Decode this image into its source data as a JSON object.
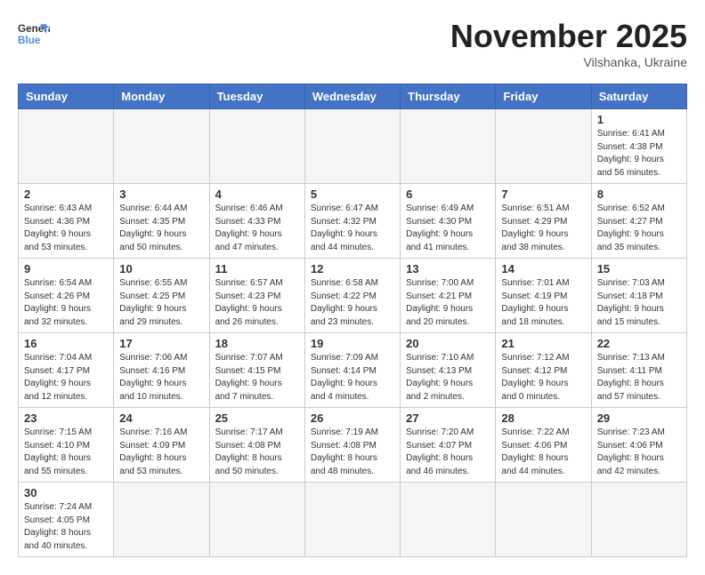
{
  "logo": {
    "line1": "General",
    "line2": "Blue"
  },
  "title": "November 2025",
  "subtitle": "Vilshanka, Ukraine",
  "days_of_week": [
    "Sunday",
    "Monday",
    "Tuesday",
    "Wednesday",
    "Thursday",
    "Friday",
    "Saturday"
  ],
  "weeks": [
    [
      {
        "day": "",
        "info": ""
      },
      {
        "day": "",
        "info": ""
      },
      {
        "day": "",
        "info": ""
      },
      {
        "day": "",
        "info": ""
      },
      {
        "day": "",
        "info": ""
      },
      {
        "day": "",
        "info": ""
      },
      {
        "day": "1",
        "info": "Sunrise: 6:41 AM\nSunset: 4:38 PM\nDaylight: 9 hours\nand 56 minutes."
      }
    ],
    [
      {
        "day": "2",
        "info": "Sunrise: 6:43 AM\nSunset: 4:36 PM\nDaylight: 9 hours\nand 53 minutes."
      },
      {
        "day": "3",
        "info": "Sunrise: 6:44 AM\nSunset: 4:35 PM\nDaylight: 9 hours\nand 50 minutes."
      },
      {
        "day": "4",
        "info": "Sunrise: 6:46 AM\nSunset: 4:33 PM\nDaylight: 9 hours\nand 47 minutes."
      },
      {
        "day": "5",
        "info": "Sunrise: 6:47 AM\nSunset: 4:32 PM\nDaylight: 9 hours\nand 44 minutes."
      },
      {
        "day": "6",
        "info": "Sunrise: 6:49 AM\nSunset: 4:30 PM\nDaylight: 9 hours\nand 41 minutes."
      },
      {
        "day": "7",
        "info": "Sunrise: 6:51 AM\nSunset: 4:29 PM\nDaylight: 9 hours\nand 38 minutes."
      },
      {
        "day": "8",
        "info": "Sunrise: 6:52 AM\nSunset: 4:27 PM\nDaylight: 9 hours\nand 35 minutes."
      }
    ],
    [
      {
        "day": "9",
        "info": "Sunrise: 6:54 AM\nSunset: 4:26 PM\nDaylight: 9 hours\nand 32 minutes."
      },
      {
        "day": "10",
        "info": "Sunrise: 6:55 AM\nSunset: 4:25 PM\nDaylight: 9 hours\nand 29 minutes."
      },
      {
        "day": "11",
        "info": "Sunrise: 6:57 AM\nSunset: 4:23 PM\nDaylight: 9 hours\nand 26 minutes."
      },
      {
        "day": "12",
        "info": "Sunrise: 6:58 AM\nSunset: 4:22 PM\nDaylight: 9 hours\nand 23 minutes."
      },
      {
        "day": "13",
        "info": "Sunrise: 7:00 AM\nSunset: 4:21 PM\nDaylight: 9 hours\nand 20 minutes."
      },
      {
        "day": "14",
        "info": "Sunrise: 7:01 AM\nSunset: 4:19 PM\nDaylight: 9 hours\nand 18 minutes."
      },
      {
        "day": "15",
        "info": "Sunrise: 7:03 AM\nSunset: 4:18 PM\nDaylight: 9 hours\nand 15 minutes."
      }
    ],
    [
      {
        "day": "16",
        "info": "Sunrise: 7:04 AM\nSunset: 4:17 PM\nDaylight: 9 hours\nand 12 minutes."
      },
      {
        "day": "17",
        "info": "Sunrise: 7:06 AM\nSunset: 4:16 PM\nDaylight: 9 hours\nand 10 minutes."
      },
      {
        "day": "18",
        "info": "Sunrise: 7:07 AM\nSunset: 4:15 PM\nDaylight: 9 hours\nand 7 minutes."
      },
      {
        "day": "19",
        "info": "Sunrise: 7:09 AM\nSunset: 4:14 PM\nDaylight: 9 hours\nand 4 minutes."
      },
      {
        "day": "20",
        "info": "Sunrise: 7:10 AM\nSunset: 4:13 PM\nDaylight: 9 hours\nand 2 minutes."
      },
      {
        "day": "21",
        "info": "Sunrise: 7:12 AM\nSunset: 4:12 PM\nDaylight: 9 hours\nand 0 minutes."
      },
      {
        "day": "22",
        "info": "Sunrise: 7:13 AM\nSunset: 4:11 PM\nDaylight: 8 hours\nand 57 minutes."
      }
    ],
    [
      {
        "day": "23",
        "info": "Sunrise: 7:15 AM\nSunset: 4:10 PM\nDaylight: 8 hours\nand 55 minutes."
      },
      {
        "day": "24",
        "info": "Sunrise: 7:16 AM\nSunset: 4:09 PM\nDaylight: 8 hours\nand 53 minutes."
      },
      {
        "day": "25",
        "info": "Sunrise: 7:17 AM\nSunset: 4:08 PM\nDaylight: 8 hours\nand 50 minutes."
      },
      {
        "day": "26",
        "info": "Sunrise: 7:19 AM\nSunset: 4:08 PM\nDaylight: 8 hours\nand 48 minutes."
      },
      {
        "day": "27",
        "info": "Sunrise: 7:20 AM\nSunset: 4:07 PM\nDaylight: 8 hours\nand 46 minutes."
      },
      {
        "day": "28",
        "info": "Sunrise: 7:22 AM\nSunset: 4:06 PM\nDaylight: 8 hours\nand 44 minutes."
      },
      {
        "day": "29",
        "info": "Sunrise: 7:23 AM\nSunset: 4:06 PM\nDaylight: 8 hours\nand 42 minutes."
      }
    ],
    [
      {
        "day": "30",
        "info": "Sunrise: 7:24 AM\nSunset: 4:05 PM\nDaylight: 8 hours\nand 40 minutes."
      },
      {
        "day": "",
        "info": ""
      },
      {
        "day": "",
        "info": ""
      },
      {
        "day": "",
        "info": ""
      },
      {
        "day": "",
        "info": ""
      },
      {
        "day": "",
        "info": ""
      },
      {
        "day": "",
        "info": ""
      }
    ]
  ]
}
